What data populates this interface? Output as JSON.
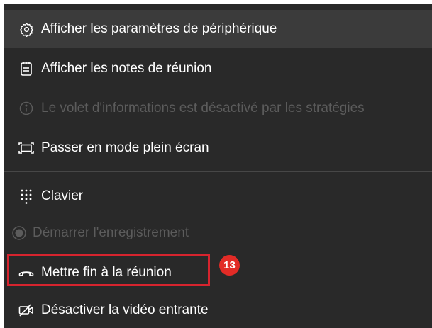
{
  "menu": {
    "items": [
      {
        "label": "Afficher les paramètres de périphérique",
        "icon": "gear-icon",
        "state": "hover"
      },
      {
        "label": "Afficher les notes de réunion",
        "icon": "notes-icon",
        "state": "enabled"
      },
      {
        "label": "Le volet d'informations est désactivé par les stratégies",
        "icon": "info-icon",
        "state": "disabled"
      },
      {
        "label": "Passer en mode plein écran",
        "icon": "fullscreen-icon",
        "state": "enabled"
      },
      {
        "label": "Clavier",
        "icon": "dialpad-icon",
        "state": "enabled"
      },
      {
        "label": "Démarrer l'enregistrement",
        "icon": "record-icon",
        "state": "disabled"
      },
      {
        "label": "Mettre fin à la réunion",
        "icon": "hang-up-icon",
        "state": "enabled"
      },
      {
        "label": "Désactiver la vidéo entrante",
        "icon": "video-off-icon",
        "state": "enabled"
      }
    ]
  },
  "annotation": {
    "step_number": "13",
    "highlight_color": "#d6242e",
    "badge_color": "#e22b26"
  },
  "colors": {
    "menu_background": "#292929",
    "hover_background": "#3b3b3b",
    "text": "#ffffff",
    "disabled_text": "#5c5c5c"
  }
}
